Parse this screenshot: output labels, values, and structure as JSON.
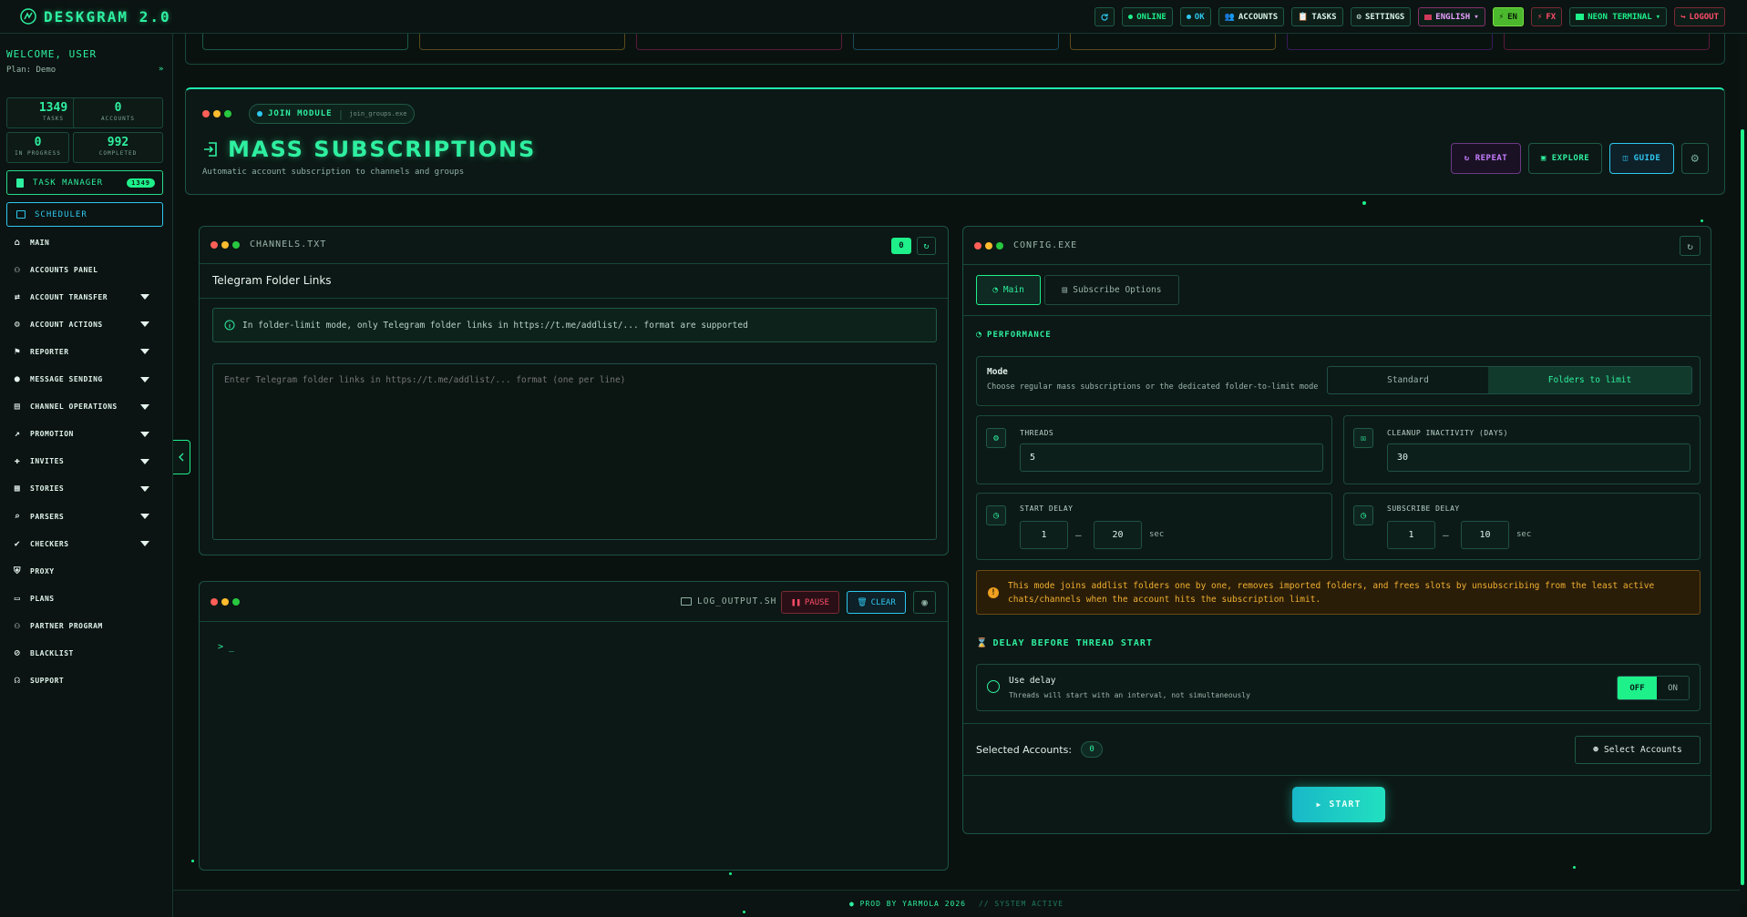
{
  "app": {
    "title": "DESKGRAM 2.0"
  },
  "topbar": {
    "online": "ONLINE",
    "ok": "OK",
    "accounts": "ACCOUNTS",
    "tasks": "TASKS",
    "settings": "SETTINGS",
    "language": "ENGLISH",
    "en": "EN",
    "fx": "FX",
    "theme": "NEON TERMINAL",
    "logout": "LOGOUT"
  },
  "sidebar": {
    "welcome": "WELCOME, USER",
    "plan": "Plan: Demo",
    "plan_arrow": "»",
    "stats": [
      {
        "value": "1349",
        "label": "TASKS"
      },
      {
        "value": "0",
        "label": "ACCOUNTS"
      },
      {
        "value": "0",
        "label": "IN PROGRESS"
      },
      {
        "value": "992",
        "label": "COMPLETED"
      }
    ],
    "task_manager": "TASK MANAGER",
    "task_manager_badge": "1349",
    "scheduler": "SCHEDULER",
    "items": [
      {
        "label": "MAIN",
        "icon": "home-icon",
        "has_caret": false
      },
      {
        "label": "ACCOUNTS PANEL",
        "icon": "users-icon",
        "has_caret": false
      },
      {
        "label": "ACCOUNT TRANSFER",
        "icon": "user-swap-icon",
        "has_caret": true
      },
      {
        "label": "ACCOUNT ACTIONS",
        "icon": "user-gear-icon",
        "has_caret": true
      },
      {
        "label": "REPORTER",
        "icon": "flag-icon",
        "has_caret": true
      },
      {
        "label": "MESSAGE SENDING",
        "icon": "chat-icon",
        "has_caret": true
      },
      {
        "label": "CHANNEL OPERATIONS",
        "icon": "folder-icon",
        "has_caret": true
      },
      {
        "label": "PROMOTION",
        "icon": "chart-icon",
        "has_caret": true
      },
      {
        "label": "INVITES",
        "icon": "user-plus-icon",
        "has_caret": true
      },
      {
        "label": "STORIES",
        "icon": "stories-icon",
        "has_caret": true
      },
      {
        "label": "PARSERS",
        "icon": "search-icon",
        "has_caret": true
      },
      {
        "label": "CHECKERS",
        "icon": "check-circle-icon",
        "has_caret": true
      },
      {
        "label": "PROXY",
        "icon": "shield-icon",
        "has_caret": false
      },
      {
        "label": "PLANS",
        "icon": "card-icon",
        "has_caret": false
      },
      {
        "label": "PARTNER PROGRAM",
        "icon": "partners-icon",
        "has_caret": false
      },
      {
        "label": "BLACKLIST",
        "icon": "user-block-icon",
        "has_caret": false
      },
      {
        "label": "SUPPORT",
        "icon": "headset-icon",
        "has_caret": false
      }
    ]
  },
  "module": {
    "chip": "JOIN MODULE",
    "chip_file": "join_groups.exe",
    "title": "MASS SUBSCRIPTIONS",
    "subtitle": "Automatic account subscription to channels and groups",
    "repeat": "REPEAT",
    "explore": "EXPLORE",
    "guide": "GUIDE"
  },
  "channels": {
    "file": "CHANNELS.TXT",
    "count": "0",
    "heading": "Telegram Folder Links",
    "info": "In folder-limit mode, only Telegram folder links in https://t.me/addlist/... format are supported",
    "placeholder": "Enter Telegram folder links in https://t.me/addlist/... format (one per line)"
  },
  "log": {
    "file": "LOG_OUTPUT.SH",
    "pause": "PAUSE",
    "clear": "CLEAR",
    "prompt": "> _"
  },
  "config": {
    "file": "CONFIG.EXE",
    "tab_main": "Main",
    "tab_subscribe": "Subscribe Options",
    "performance": "PERFORMANCE",
    "mode_label": "Mode",
    "mode_desc": "Choose regular mass subscriptions or the dedicated folder-to-limit mode",
    "mode_standard": "Standard",
    "mode_folders": "Folders to limit",
    "threads_label": "THREADS",
    "threads_value": "5",
    "cleanup_label": "CLEANUP INACTIVITY (DAYS)",
    "cleanup_value": "30",
    "start_delay_label": "START DELAY",
    "start_delay_min": "1",
    "start_delay_max": "20",
    "subscribe_delay_label": "SUBSCRIBE DELAY",
    "subscribe_delay_min": "1",
    "subscribe_delay_max": "10",
    "dash": "—",
    "sec": "sec",
    "warning": "This mode joins addlist folders one by one, removes imported folders, and frees slots by unsubscribing from the least active chats/channels when the account hits the subscription limit.",
    "delay_section": "DELAY BEFORE THREAD START",
    "use_delay": "Use delay",
    "use_delay_desc": "Threads will start with an interval, not simultaneously",
    "off": "OFF",
    "on": "ON",
    "selected_accounts": "Selected Accounts:",
    "selected_count": "0",
    "select_accounts": "Select Accounts",
    "start": "START"
  },
  "footer": {
    "text": "PROD BY YARMOLA 2026",
    "status": "// SYSTEM ACTIVE"
  }
}
